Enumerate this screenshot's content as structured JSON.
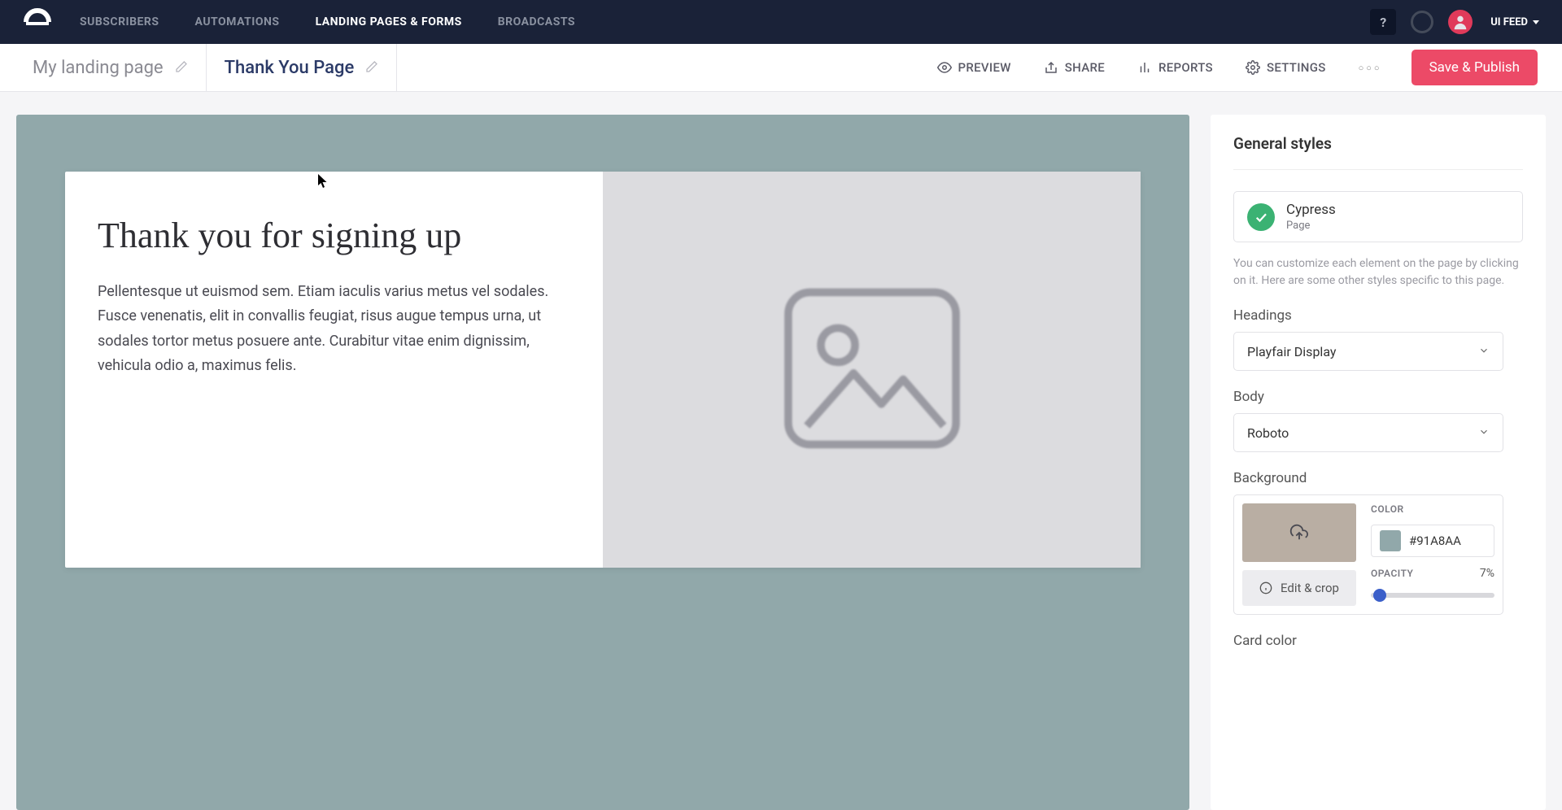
{
  "nav": {
    "links": [
      "SUBSCRIBERS",
      "AUTOMATIONS",
      "LANDING PAGES & FORMS",
      "BROADCASTS"
    ],
    "active_index": 2,
    "help": "?",
    "user_label": "UI FEED"
  },
  "subbar": {
    "tabs": [
      {
        "label": "My landing page",
        "active": false
      },
      {
        "label": "Thank You Page",
        "active": true
      }
    ],
    "actions": {
      "preview": "PREVIEW",
      "share": "SHARE",
      "reports": "REPORTS",
      "settings": "SETTINGS"
    },
    "publish": "Save & Publish"
  },
  "canvas": {
    "heading": "Thank you for signing up",
    "body": "Pellentesque ut euismod sem. Etiam iaculis varius metus vel sodales. Fusce venenatis, elit in convallis feugiat, risus augue tempus urna, ut sodales tortor metus posuere ante. Curabitur vitae enim dignissim, vehicula odio a, maximus felis."
  },
  "sidebar": {
    "title": "General styles",
    "template": {
      "name": "Cypress",
      "type": "Page"
    },
    "description": "You can customize each element on the page by clicking on it. Here are some other styles specific to this page.",
    "headings_label": "Headings",
    "headings_value": "Playfair Display",
    "body_label": "Body",
    "body_value": "Roboto",
    "background_label": "Background",
    "color_label": "COLOR",
    "color_value": "#91A8AA",
    "opacity_label": "OPACITY",
    "opacity_value": "7%",
    "edit_crop": "Edit & crop",
    "card_color_label": "Card color"
  }
}
